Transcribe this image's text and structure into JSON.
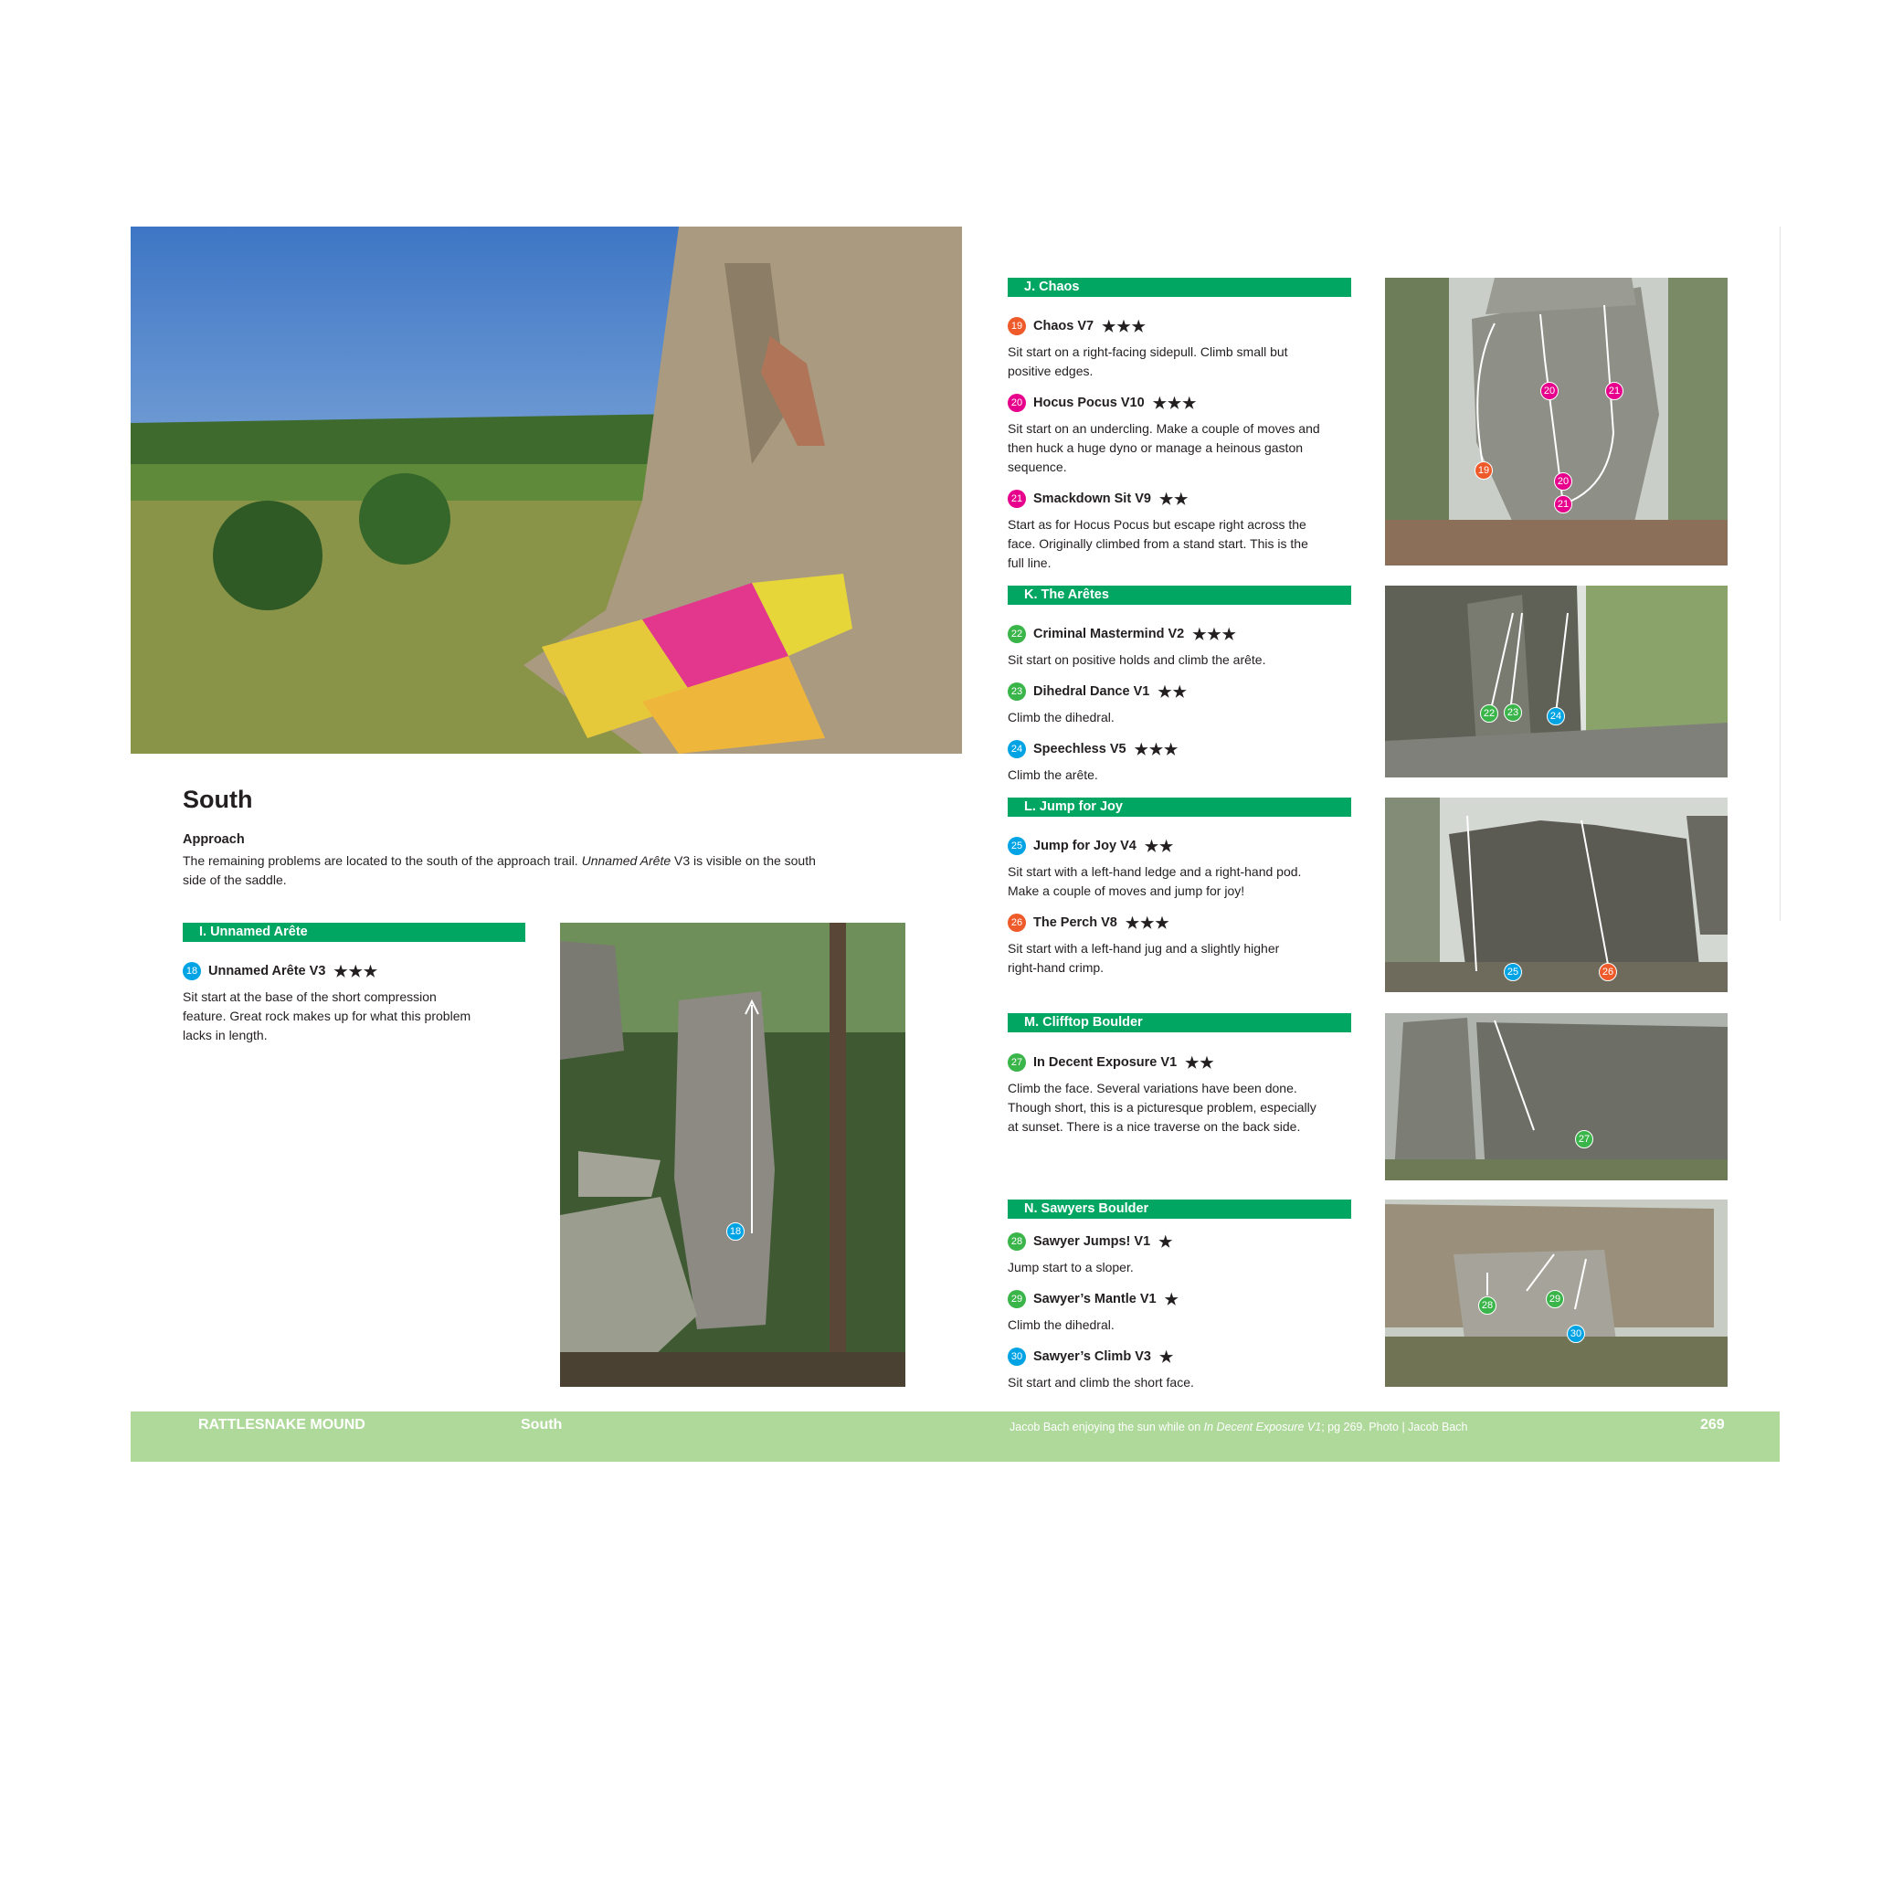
{
  "colors": {
    "green_bar": "#00a662",
    "footer_bg": "#aed99a",
    "orange": "#ee5a2a",
    "magenta": "#e6008c",
    "green_num": "#3ab54a",
    "blue": "#00a4e4"
  },
  "left": {
    "title": "South",
    "approach_label": "Approach",
    "approach_text_1": "The remaining problems are located to the south of the approach trail.",
    "approach_italic": "Unnamed Arête",
    "approach_text_2": " V3 is visible on the south",
    "approach_line2": "side of the saddle.",
    "section": "I. Unnamed Arête",
    "problem": {
      "num": "18",
      "name": "Unnamed Arête V3",
      "stars": "★★★"
    },
    "desc": [
      "Sit start at the base of the short compression",
      "feature. Great rock makes up for what this problem",
      "lacks in length."
    ],
    "photo_marker": "18"
  },
  "sections": [
    {
      "title": "J. Chaos",
      "problems": [
        {
          "num": "19",
          "name": "Chaos V7",
          "stars": "★★★",
          "desc": [
            "Sit start on a right-facing sidepull. Climb small but",
            "positive edges."
          ]
        },
        {
          "num": "20",
          "name": "Hocus Pocus V10",
          "stars": "★★★",
          "desc": [
            "Sit start on an undercling. Make a couple of moves and",
            "then huck a huge dyno or manage a heinous gaston",
            "sequence."
          ]
        },
        {
          "num": "21",
          "name": "Smackdown Sit V9",
          "stars": "★★",
          "desc": [
            "Start as for Hocus Pocus but escape right across the",
            "face. Originally climbed from a stand start. This is the",
            "full line."
          ]
        }
      ]
    },
    {
      "title": "K. The Arêtes",
      "problems": [
        {
          "num": "22",
          "name": "Criminal Mastermind V2",
          "stars": "★★★",
          "desc": [
            "Sit start on positive holds and climb the arête."
          ]
        },
        {
          "num": "23",
          "name": "Dihedral Dance V1",
          "stars": "★★",
          "desc": [
            "Climb the dihedral."
          ]
        },
        {
          "num": "24",
          "name": "Speechless V5",
          "stars": "★★★",
          "desc": [
            "Climb the arête."
          ]
        }
      ]
    },
    {
      "title": "L. Jump for Joy",
      "problems": [
        {
          "num": "25",
          "name": "Jump for Joy V4",
          "stars": "★★",
          "desc": [
            "Sit start with a left-hand ledge and a right-hand pod.",
            "Make a couple of moves and jump for joy!"
          ]
        },
        {
          "num": "26",
          "name": "The Perch V8",
          "stars": "★★★",
          "desc": [
            "Sit start with a left-hand jug and a slightly higher",
            "right-hand crimp."
          ]
        }
      ]
    },
    {
      "title": "M. Clifftop Boulder",
      "problems": [
        {
          "num": "27",
          "name": "In Decent Exposure V1",
          "stars": "★★",
          "desc": [
            "Climb the face. Several variations have been done.",
            "Though short, this is a picturesque problem, especially",
            "at sunset. There is a nice traverse on the back side."
          ]
        }
      ]
    },
    {
      "title": "N. Sawyers Boulder",
      "problems": [
        {
          "num": "28",
          "name": "Sawyer Jumps! V1",
          "stars": "★",
          "desc": [
            "Jump start to a sloper."
          ]
        },
        {
          "num": "29",
          "name": "Sawyer’s Mantle V1",
          "stars": "★",
          "desc": [
            "Climb the dihedral."
          ]
        },
        {
          "num": "30",
          "name": "Sawyer’s Climb V3",
          "stars": "★",
          "desc": [
            "Sit start and climb the short face."
          ]
        }
      ]
    }
  ],
  "photo_markers": {
    "chaos": [
      "20",
      "21",
      "19",
      "20",
      "21"
    ],
    "aretes": [
      "22",
      "23",
      "24"
    ],
    "jump": [
      "25",
      "26"
    ],
    "clifftop": [
      "27"
    ],
    "sawyers": [
      "28",
      "29",
      "30"
    ]
  },
  "footer": {
    "area": "RATTLESNAKE MOUND",
    "section": "South",
    "caption_1": "Jacob Bach enjoying the sun while on ",
    "caption_italic": "In Decent Exposure V1",
    "caption_2": "; pg 269. Photo | Jacob Bach",
    "page": "269"
  }
}
